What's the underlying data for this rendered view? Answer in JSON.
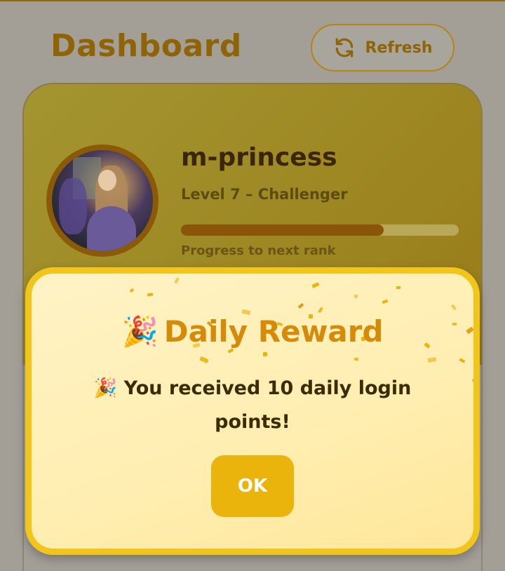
{
  "header": {
    "title": "Dashboard",
    "refresh_label": "Refresh",
    "refresh_icon": "refresh-icon"
  },
  "profile": {
    "username": "m-princess",
    "level_text": "Level 7 – Challenger",
    "progress_label": "Progress to next rank",
    "progress_fraction": 0.73,
    "avatar": "avatar-image"
  },
  "modal": {
    "title_emoji": "🎉",
    "title": "Daily Reward",
    "message": "🎉 You received 10 daily login points!",
    "ok_label": "OK"
  },
  "colors": {
    "accent": "#eab40c",
    "title_orange": "#d58a08",
    "brown": "#8a5508"
  }
}
